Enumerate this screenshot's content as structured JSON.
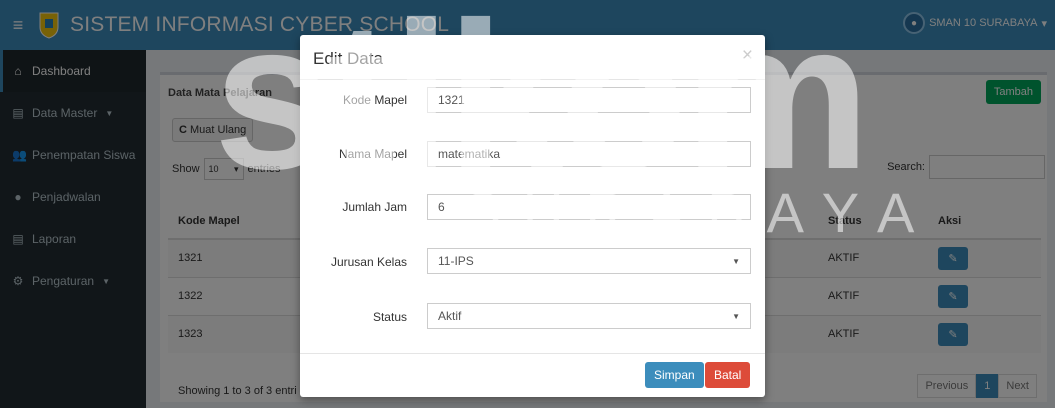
{
  "header": {
    "title": "SISTEM INFORMASI CYBER SCHOOL",
    "school": "SMAN 10 SURABAYA"
  },
  "sidebar": {
    "items": [
      {
        "label": "Dashboard",
        "icon": "home-icon"
      },
      {
        "label": "Data Master",
        "icon": "book-icon",
        "caret": "▼"
      },
      {
        "label": "Penempatan Siswa",
        "icon": "users-icon"
      },
      {
        "label": "Penjadwalan",
        "icon": "circle-icon"
      },
      {
        "label": "Laporan",
        "icon": "file-icon"
      },
      {
        "label": "Pengaturan",
        "icon": "gear-icon",
        "caret": "▼"
      }
    ]
  },
  "panel": {
    "title": "Data Mata Pelajaran",
    "add_label": "Tambah",
    "reload_label": "Muat Ulang",
    "show_label": "Show",
    "entries_value": "10",
    "entries_label": "entries",
    "search_label": "Search:"
  },
  "table": {
    "columns": [
      "Kode Mapel",
      "",
      "",
      "",
      "Status",
      "Aksi"
    ],
    "rows": [
      {
        "kode": "1321",
        "status": "AKTIF"
      },
      {
        "kode": "1322",
        "status": "AKTIF"
      },
      {
        "kode": "1323",
        "status": "AKTIF"
      }
    ],
    "info": "Showing 1 to 3 of 3 entri",
    "pager": {
      "prev": "Previous",
      "current": "1",
      "next": "Next"
    }
  },
  "modal": {
    "title": "Edit Data",
    "close": "×",
    "fields": [
      {
        "label": "Kode Mapel",
        "value": "1321"
      },
      {
        "label": "Nama Mapel",
        "value": "matematika"
      },
      {
        "label": "Jumlah Jam",
        "value": "6"
      },
      {
        "label": "Jurusan Kelas",
        "value": "11-IPS"
      },
      {
        "label": "Status",
        "value": "Aktif"
      }
    ],
    "save_label": "Simpan",
    "cancel_label": "Batal"
  },
  "watermark": {
    "main": "stikom",
    "sub": "SURABAYA"
  },
  "colors": {
    "navbar": "#3c8dbc",
    "sidebar": "#222d32",
    "success": "#00a65a",
    "danger": "#dd4b39"
  }
}
